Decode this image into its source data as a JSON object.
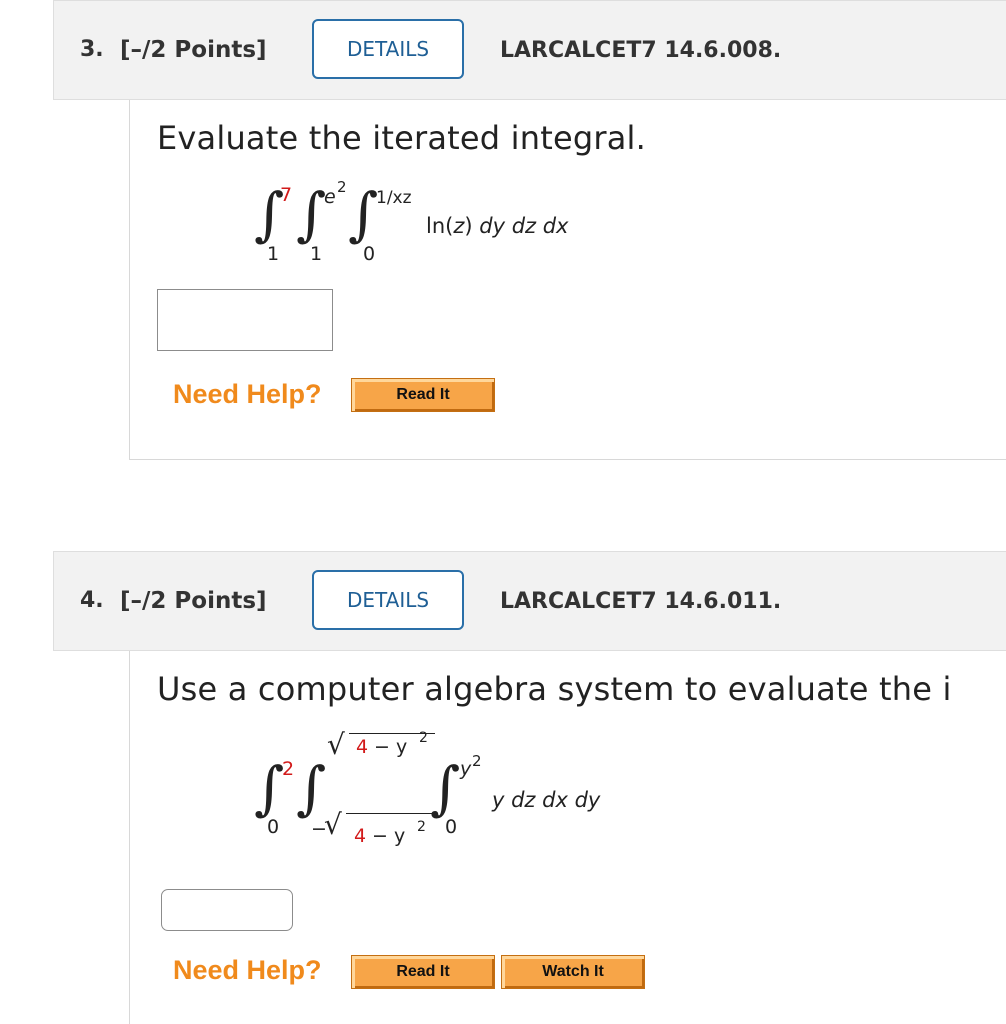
{
  "questions": [
    {
      "number": "3.",
      "points": "[–/2 Points]",
      "details_label": "DETAILS",
      "code": "LARCALCET7 14.6.008.",
      "prompt": "Evaluate the iterated integral.",
      "integral": {
        "outer": {
          "upper": "7",
          "lower": "1"
        },
        "middle": {
          "upper_base": "e",
          "upper_exp": "2",
          "lower": "1"
        },
        "inner": {
          "upper": "1/xz",
          "lower": "0"
        },
        "integrand_fn": "ln(",
        "integrand_var": "z",
        "integrand_close": ")",
        "differentials": "dy dz dx"
      },
      "answer_value": "",
      "need_help_label": "Need Help?",
      "help_buttons": [
        "Read It"
      ]
    },
    {
      "number": "4.",
      "points": "[–/2 Points]",
      "details_label": "DETAILS",
      "code": "LARCALCET7 14.6.011.",
      "prompt": "Use a computer algebra system to evaluate the i",
      "integral": {
        "outer": {
          "upper": "2",
          "lower": "0"
        },
        "middle": {
          "upper_num": "4",
          "upper_rest": "− y",
          "upper_exp": "2",
          "lower_sign": "−",
          "lower_num": "4",
          "lower_rest": "− y",
          "lower_exp": "2"
        },
        "inner": {
          "upper_base": "y",
          "upper_exp": "2",
          "lower": "0"
        },
        "integrand": "y dz dx dy"
      },
      "answer_value": "",
      "need_help_label": "Need Help?",
      "help_buttons": [
        "Read It",
        "Watch It"
      ]
    }
  ],
  "colors": {
    "accent_red": "#d21a1a",
    "details_border": "#2a6fa8",
    "need_help": "#f08a1c",
    "help_button": "#f7a548"
  }
}
